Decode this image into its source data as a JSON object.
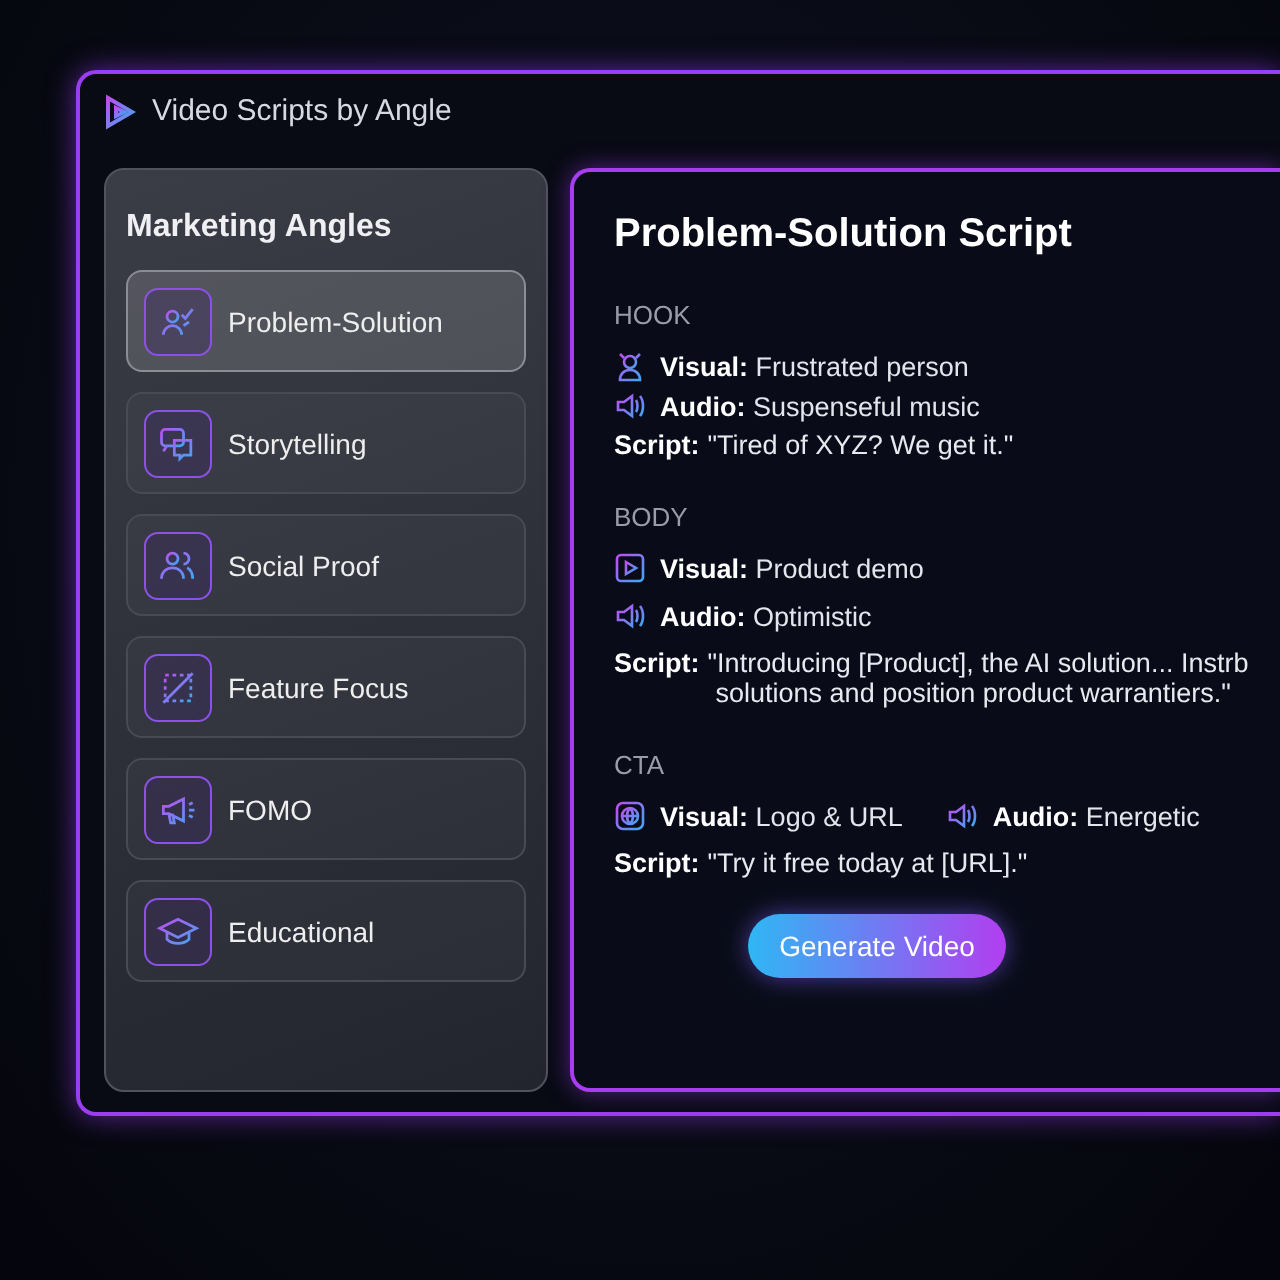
{
  "window": {
    "title": "Video Scripts by Angle"
  },
  "sidebar": {
    "title": "Marketing Angles",
    "items": [
      {
        "label": "Problem-Solution",
        "kind": "person-check",
        "selected": true
      },
      {
        "label": "Storytelling",
        "kind": "chat",
        "selected": false
      },
      {
        "label": "Social Proof",
        "kind": "people",
        "selected": false
      },
      {
        "label": "Feature Focus",
        "kind": "frame",
        "selected": false
      },
      {
        "label": "FOMO",
        "kind": "megaphone",
        "selected": false
      },
      {
        "label": "Educational",
        "kind": "cap",
        "selected": false
      }
    ]
  },
  "script": {
    "title": "Problem-Solution Script",
    "sections": [
      {
        "heading": "HOOK",
        "lines": [
          {
            "items": [
              {
                "kind": "person",
                "label": "Visual:",
                "value": "Frustrated person"
              }
            ]
          },
          {
            "items": [
              {
                "kind": "speaker",
                "label": "Audio:",
                "value": "Suspenseful music"
              }
            ]
          }
        ],
        "script": {
          "label": "Script:",
          "lines": [
            "\"Tired of XYZ? We get it.\""
          ]
        }
      },
      {
        "heading": "BODY",
        "lines": [
          {
            "items": [
              {
                "kind": "play",
                "label": "Visual:",
                "value": "Product demo"
              }
            ]
          },
          {
            "items": [
              {
                "kind": "speaker",
                "label": "Audio:",
                "value": "Optimistic"
              }
            ]
          }
        ],
        "script": {
          "label": "Script:",
          "lines": [
            "\"Introducing [Product], the AI solution... Instrb",
            "solutions and position product warrantiers.\""
          ]
        }
      },
      {
        "heading": "CTA",
        "lines": [
          {
            "items": [
              {
                "kind": "globe",
                "label": "Visual:",
                "value": "Logo & URL"
              },
              {
                "kind": "speaker",
                "label": "Audio:",
                "value": "Energetic"
              }
            ]
          }
        ],
        "script": {
          "label": "Script:",
          "lines": [
            "\"Try it free today at [URL].\""
          ]
        }
      }
    ],
    "button": "Generate Video"
  }
}
